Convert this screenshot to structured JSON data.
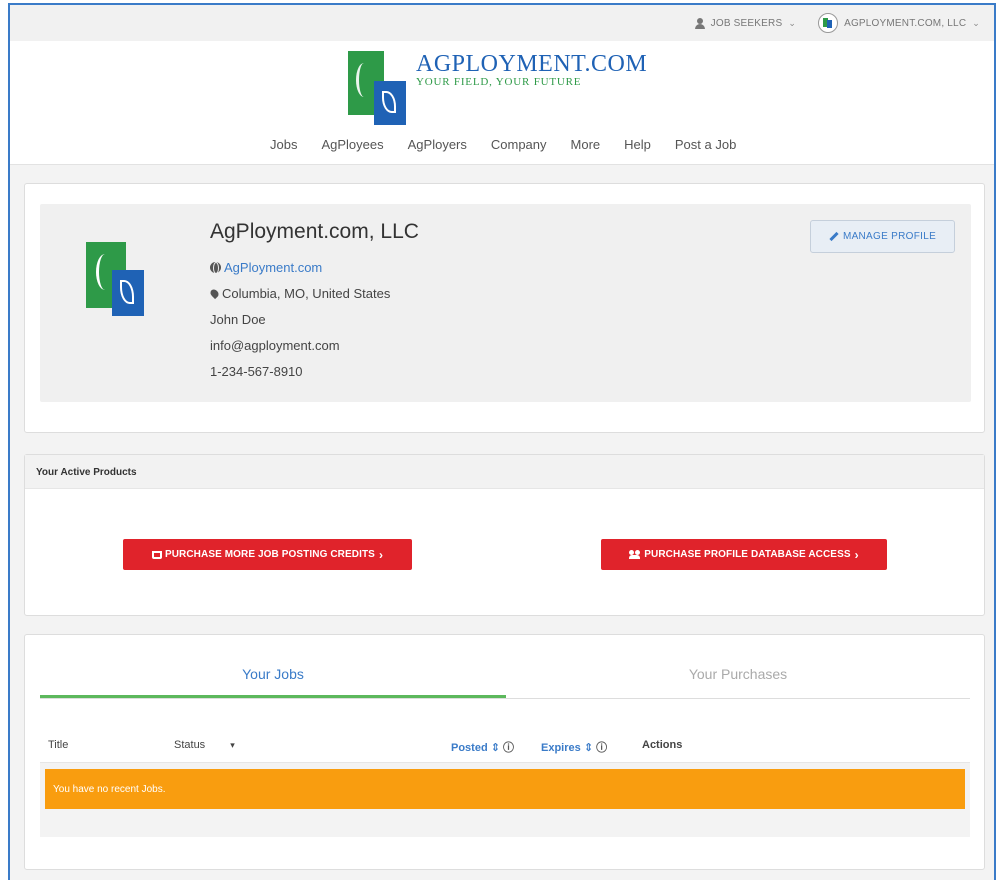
{
  "utility": {
    "job_seekers": "JOB SEEKERS",
    "company_menu": "AGPLOYMENT.COM, LLC"
  },
  "brand": {
    "title": "AGPLOYMENT.COM",
    "tagline": "YOUR FIELD, YOUR FUTURE"
  },
  "nav": [
    "Jobs",
    "AgPloyees",
    "AgPloyers",
    "Company",
    "More",
    "Help",
    "Post a Job"
  ],
  "profile": {
    "company_name": "AgPloyment.com, LLC",
    "website": "AgPloyment.com",
    "location": "Columbia, MO, United States",
    "contact": "John Doe",
    "email": "info@agployment.com",
    "phone": "1-234-567-8910",
    "manage_label": "MANAGE PROFILE"
  },
  "products": {
    "header": "Your Active Products",
    "purchase_credits": "PURCHASE MORE JOB POSTING CREDITS",
    "purchase_db": "PURCHASE PROFILE DATABASE ACCESS"
  },
  "jobs": {
    "tabs": [
      "Your Jobs",
      "Your Purchases"
    ],
    "columns": {
      "title": "Title",
      "status": "Status",
      "posted": "Posted",
      "expires": "Expires",
      "actions": "Actions"
    },
    "empty_message": "You have no recent Jobs."
  },
  "colors": {
    "brand_green": "#2e9a48",
    "brand_blue": "#1f62b5",
    "cta_red": "#e0232b",
    "alert_orange": "#f99d0f",
    "link_blue": "#3a7bc8"
  }
}
